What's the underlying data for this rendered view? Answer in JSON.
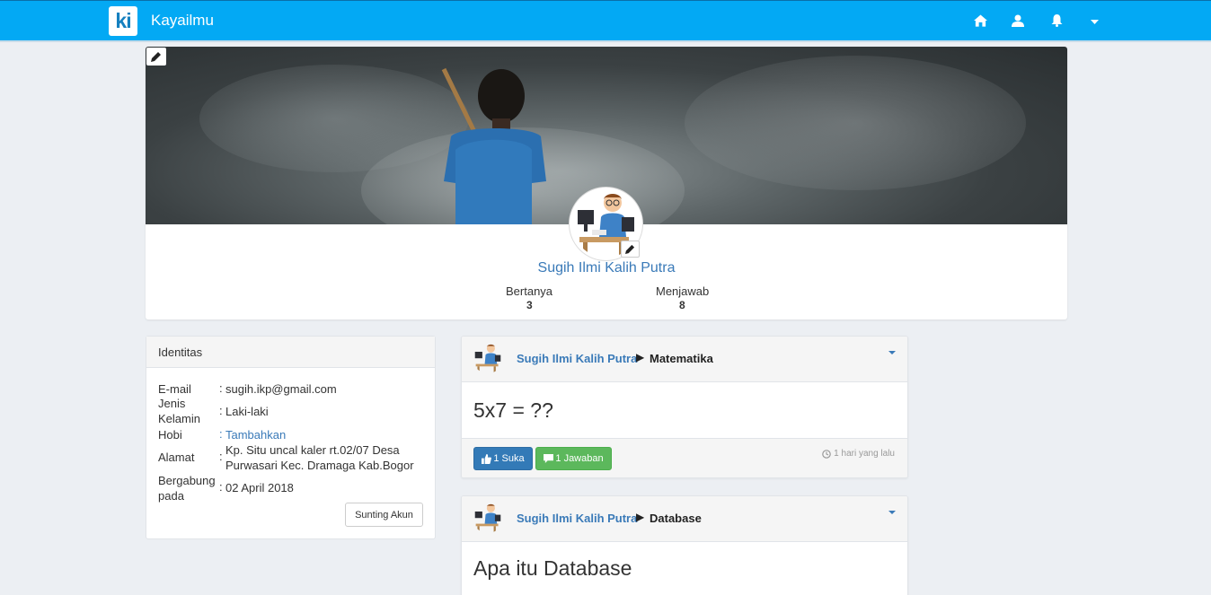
{
  "navbar": {
    "logo_text": "ki",
    "brand": "Kayailmu",
    "icons": [
      "home-icon",
      "user-icon",
      "bell-icon",
      "caret-down-icon"
    ],
    "color": "#03a9f4"
  },
  "profile": {
    "name": "Sugih Ilmi Kalih Putra",
    "stats": [
      {
        "label": "Bertanya",
        "value": "3"
      },
      {
        "label": "Menjawab",
        "value": "8"
      }
    ]
  },
  "identity": {
    "title": "Identitas",
    "rows": [
      {
        "label": "E-mail",
        "value": "sugih.ikp@gmail.com"
      },
      {
        "label_line1": "Jenis",
        "label_line2": "Kelamin",
        "value": "Laki-laki"
      },
      {
        "label": "Hobi",
        "value": "Tambahkan"
      },
      {
        "label": "Alamat",
        "value_line1": "Kp. Situ uncal kaler rt.02/07 Desa",
        "value_line2": "Purwasari Kec. Dramaga Kab.Bogor"
      },
      {
        "label_line1": "Bergabung",
        "label_line2": "pada",
        "value": "02 April 2018"
      }
    ],
    "edit_button": "Sunting Akun"
  },
  "questions": [
    {
      "author": "Sugih Ilmi Kalih Putra",
      "subject": "Matematika",
      "text": "5x7 = ??",
      "like_label": "1 Suka",
      "answer_label": "1 Jawaban",
      "time": "1 hari yang lalu"
    },
    {
      "author": "Sugih Ilmi Kalih Putra",
      "subject": "Database",
      "text": "Apa itu Database"
    }
  ]
}
